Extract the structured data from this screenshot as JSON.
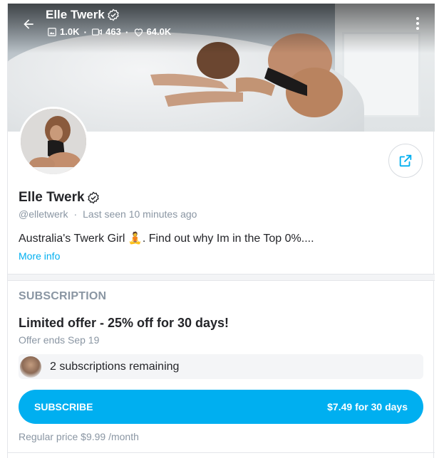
{
  "header": {
    "name": "Elle Twerk",
    "stats": {
      "photos": "1.0K",
      "videos": "463",
      "likes": "64.0K"
    }
  },
  "profile": {
    "name": "Elle Twerk",
    "handle": "@elletwerk",
    "last_seen": "Last seen 10 minutes ago",
    "bio": "Australia's Twerk Girl 🧘. Find out why Im in the Top 0%....",
    "more_info": "More info"
  },
  "subscription": {
    "heading": "SUBSCRIPTION",
    "offer_title": "Limited offer - 25% off for 30 days!",
    "offer_ends": "Offer ends Sep 19",
    "remaining": "2 subscriptions remaining",
    "button_label": "SUBSCRIBE",
    "button_price": "$7.49 for 30 days",
    "regular_price": "Regular price $9.99 /month"
  },
  "colors": {
    "accent": "#00aff0",
    "muted": "#8a96a3",
    "text": "#242529"
  },
  "icons": [
    "back-arrow-icon",
    "verified-icon",
    "image-icon",
    "video-icon",
    "heart-icon",
    "more-vertical-icon",
    "share-icon"
  ]
}
